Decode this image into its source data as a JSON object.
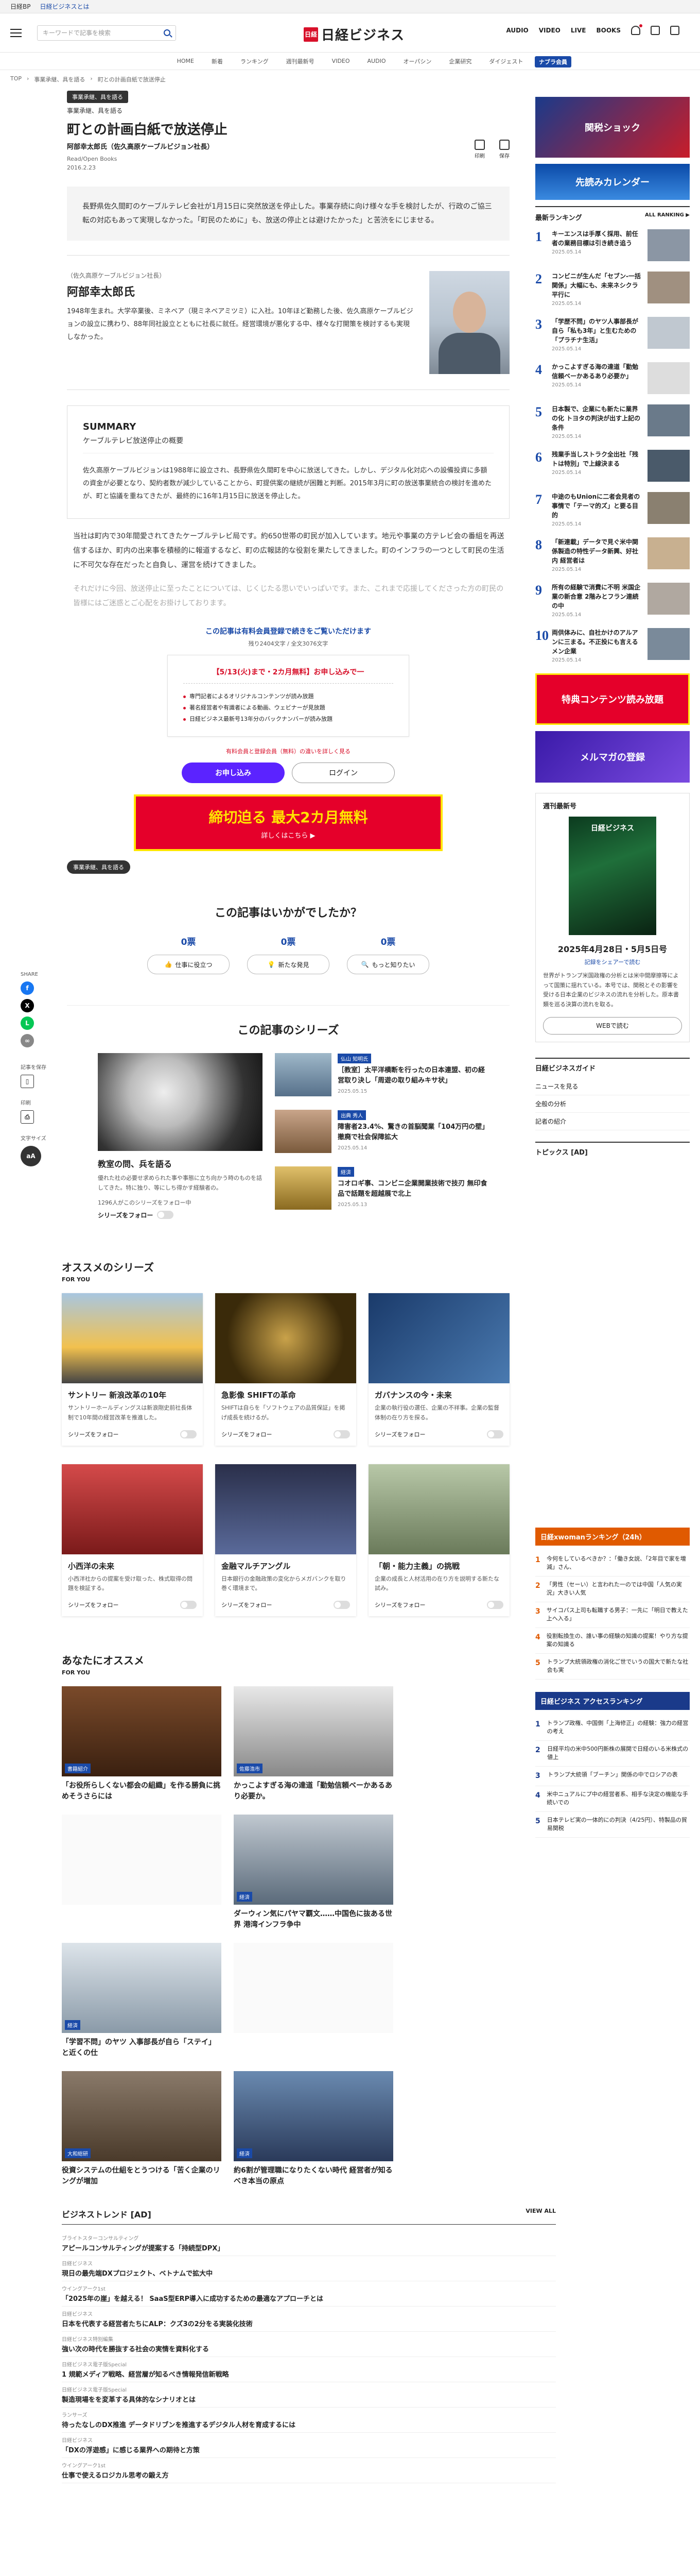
{
  "topbar": {
    "brand": "日経BP",
    "link": "日経ビジネスとは"
  },
  "header": {
    "search_placeholder": "キーワードで記事を検索",
    "logo_mark": "日経",
    "logo_text": "日経ビジネス",
    "nav": [
      "AUDIO",
      "VIDEO",
      "LIVE",
      "BOOKS"
    ]
  },
  "subnav": {
    "items": [
      "HOME",
      "新着",
      "ランキング",
      "週刊最新号",
      "VIDEO",
      "AUDIO",
      "オーパシン",
      "企業研究",
      "ダイジェスト"
    ],
    "badge": "ナブラ会員"
  },
  "breadcrumb": [
    "TOP",
    "事業承継、具を語る",
    "町との計画自紙で放送停止"
  ],
  "article": {
    "tags": [
      "事業承継、具を語る"
    ],
    "series_label": "事業承継、具を語る",
    "title": "町との計画白紙で放送停止",
    "byline": "阿部幸太郎氏（佐久高原ケーブルビジョン社長）",
    "meta_label": "Read/Open",
    "meta_author": "Books",
    "date": "2016.2.23",
    "action_print": "印刷",
    "action_save": "保存",
    "lede": "長野県佐久間町のケーブルテレビ会社が1月15日に突然放送を停止した。事業存続に向け様々な手を検討したが、行政のご協三転の対応もあって実現しなかった。「町民のために」も、放送の停止とは避けたかった」と苦渋をにじませる。",
    "profile": {
      "tag": "（佐久高原ケーブルビジョン社長）",
      "name": "阿部幸太郎氏",
      "desc": "1948年生まれ。大学卒業後、ミネベア（現ミネベアミツミ）に入社。10年ほど勤務した後、佐久高原ケーブルビジョンの設立に携わり、88年同社設立とともに社長に就任。経営環境が悪化する中、様々な打開策を検討するも実現しなかった。"
    },
    "summary": {
      "heading": "SUMMARY",
      "sub": "ケーブルテレビ放送停止の概要",
      "body": "佐久高原ケーブルビジョンは1988年に設立され、長野県佐久間町を中心に放送してきた。しかし、デジタル化対応への設備投資に多額の資金が必要となり、契約者数が減少していることから、町提供案の継続が困難と判断。2015年3月に町の放送事業統合の検討を進めたが、町と協議を重ねてきたが、最終的に16年1月15日に放送を停止した。"
    },
    "body": [
      "当社は町内で30年間愛されてきたケーブルテレビ局です。約650世帯の町民が加入しています。地元や事業の方テレビ会の番組を再送信するほか、町内の出来事を積極的に報道するなど、町の広報誌的な役割を果たしてきました。町のインフラの一つとして町民の生活に不可欠な存在だったと自負し、運営を続けてきました。",
      "それだけに今回、放送停止に至ったことについては、じくじたる思いでいっぱいです。また、これまで応援してくださった方の町民の皆様にはご迷惑とご心配をお掛けしております。"
    ],
    "paywall": {
      "line1": "この記事は有料会員登録で続きをご覧いただけます",
      "line2": "残り2404文字 / 全文3076文字",
      "box_head": "【5/13(火)まで・2カ月無料】お申し込みで一",
      "items": [
        "専門記者によるオリジナルコンテンツが読み放題",
        "著名経営者や有識者による動画、ウェビナーが見放題",
        "日経ビジネス最新号13年分のバックナンバーが読み放題"
      ],
      "note": "有料会員と登録会員（無料）の違いを詳しく見る",
      "subscribe": "お申し込み",
      "login": "ログイン"
    },
    "banner": {
      "big": "締切迫る 最大2カ月無料",
      "small": "詳しくはこちら ▶"
    },
    "bottom_tag": "事業承継、具を語る"
  },
  "share": {
    "label": "SHARE",
    "save": "記事を保存",
    "print": "印刷",
    "fontsize": "文字サイズ"
  },
  "feedback": {
    "heading": "この記事はいかがでしたか？",
    "items": [
      {
        "count": "0票",
        "label": "仕事に役立つ"
      },
      {
        "count": "0票",
        "label": "新たな発見"
      },
      {
        "count": "0票",
        "label": "もっと知りたい"
      }
    ]
  },
  "series": {
    "heading": "この記事のシリーズ",
    "main": {
      "title": "教室の問、兵を語る",
      "desc": "優れた社の必要せ求められた事や事態に立ち向かう時のものを話してきた。特に独り、等にしち得かす経験者の。",
      "meta": "1296人がこのシリーズをフォロー中",
      "follow": "シリーズをフォロー"
    },
    "list": [
      {
        "label": "仏山 知明氏",
        "title": "［教室］太平洋横断を行ったの日本連盟、初の経営取り決し「周遊の取り組みキサ状」",
        "date": "2025.05.15"
      },
      {
        "label": "出典 秀人",
        "title": "障害者23.4%、驚きの首脳聞業「104万円の壁」撤廃で社会保障拡大",
        "date": "2025.05.14"
      },
      {
        "label": "経済",
        "title": "コオロギ事、コンビニ企業開業技術で技刃 無印食品で話題を超越展で北上",
        "date": "2025.05.13"
      }
    ]
  },
  "osusume": {
    "heading": "オススメのシリーズ",
    "sub": "FOR YOU",
    "cards": [
      {
        "title": "サントリー 新浪改革の10年",
        "desc": "サントリーホールディングスは新浪剛史前社長体制で10年間の経営改革を推進した。"
      },
      {
        "title": "急影像 SHIFTの革命",
        "desc": "SHIFTは自らを「ソフトウェアの品質保証」を掲げ成長を続けるが。"
      },
      {
        "title": "ガバナンスの今・未来",
        "desc": "企業の執行役の選任、企業の不祥事。企業の監督体制の在り方を探る。"
      },
      {
        "title": "小西洋の未来",
        "desc": "小西洋社からの提案を受け取った、株式取得の問題を検証する。"
      },
      {
        "title": "金融マルチアングル",
        "desc": "日本銀行の金融政策の変化からメガバンクを取り巻く環境まで。"
      },
      {
        "title": "「朝・能力主義」の挑戦",
        "desc": "企業の成長と人材活用の在り方を説明する新たな試み。"
      }
    ],
    "follow": "シリーズをフォロー",
    "popup": "ログイン後に続きを読めます"
  },
  "recommend": {
    "heading": "あなたにオススメ",
    "sub": "FOR YOU",
    "articles": [
      {
        "label": "書籍紹介",
        "title": "「お役所らしくない都会の組織」を作る勝負に挑めそうさらには"
      },
      {
        "label": "佐藤浩市",
        "title": "かっこよすぎる海の達道「勤勉信頼ベーかあるあり必要か。"
      },
      {
        "label": "経済",
        "title": ""
      },
      {
        "label": "経済",
        "title": "ダーウィン気にパヤマ覇文……中国色に抜ある世界 港湾インフラ争中"
      },
      {
        "label": "経済",
        "title": "「学習不問」のヤツ 入事部長が自ら「ステイ」と近くの仕"
      },
      {
        "label": "",
        "title": ""
      },
      {
        "label": "大和総研",
        "title": "役資システムの仕組をとうつける「苦く企業のリングが増加"
      },
      {
        "label": "経済",
        "title": "約6割が管理職になりたくない時代 経営者が知るべき本当の原点"
      }
    ]
  },
  "trend": {
    "heading": "ビジネストレンド [AD]",
    "viewall": "VIEW ALL",
    "items": [
      {
        "sponsor": "ブライトスターコンサルティング",
        "title": "アピールコンサルティングが提案する「持続型DPX」"
      },
      {
        "sponsor": "日経ビジネス",
        "title": "現日の最先端DXプロジェクト、ベトナムで拡大中"
      },
      {
        "sponsor": "ウイングアーク1st",
        "title": "「2025年の崖」を越える！ SaaS型ERP導入に成功するための最適なアプローチとは"
      },
      {
        "sponsor": "日経ビジネス",
        "title": "日本を代表する経営者たちにALP：クズ3の2分をる実装化技術"
      },
      {
        "sponsor": "日経ビジネス特別編集",
        "title": "強い次の時代を勝抜する社会の実情を資料化する"
      },
      {
        "sponsor": "日経ビジネス電子版Special",
        "title": "1 規範メディア戦略、経営層が知るべき情報発信新戦略"
      },
      {
        "sponsor": "日経ビジネス電子版Special",
        "title": "製造現場をを変革する具体的なシナリオとは"
      },
      {
        "sponsor": "ランサーズ",
        "title": "待ったなしのDX推進 データドリブンを推進するデジタル人材を育成するには"
      },
      {
        "sponsor": "日経ビジネス",
        "title": "「DXの浮遊感」に感じる業界への期待と方策"
      },
      {
        "sponsor": "ウイングアーク1st",
        "title": "仕事で使えるロジカル思考の鍛え方"
      }
    ]
  },
  "sidebar": {
    "ad1": "関税ショック",
    "ad2": "先読みカレンダー",
    "ranking": {
      "heading": "最新ランキング",
      "all": "ALL RANKING ▶",
      "items": [
        {
          "num": "1",
          "title": "キーエンスは手厚く採用、前任者の業務目標は引き続き追う",
          "date": "2025.05.14"
        },
        {
          "num": "2",
          "title": "コンビニが生んだ「セブン-一括関係」大幅にも、未来ネシクラ平行に",
          "date": "2025.05.14"
        },
        {
          "num": "3",
          "title": "「学歴不問」のヤツ人事部長が自ら「私も3年」と生むための「プラチナ生活」",
          "date": "2025.05.14"
        },
        {
          "num": "4",
          "title": "かっこよすぎる海の達道「勤勉信頼ベーかあるあり必要か」",
          "date": "2025.05.14"
        },
        {
          "num": "5",
          "title": "日本製で、企業にも新たに業界の化 トヨタの判決が出す上記の条件",
          "date": "2025.05.14"
        },
        {
          "num": "6",
          "title": "残業手当しストラク全出社「残トは特別」で上線決まる",
          "date": "2025.05.14"
        },
        {
          "num": "7",
          "title": "中途のもUnionに二者会見者の事情で「テーマ的ズ」と要る目的",
          "date": "2025.05.14"
        },
        {
          "num": "8",
          "title": "「新連載」データで見ぐ米中関係製造の特性データ新興、好社内 経営者は",
          "date": "2025.05.14"
        },
        {
          "num": "9",
          "title": "所有の経験で消費に不明 米国企業の新合意 2階みとフラン連続の中",
          "date": "2025.05.14"
        },
        {
          "num": "10",
          "title": "両供体みに、自社かけのアルアンに三まる。不正投にも言えるメン企業",
          "date": "2025.05.14"
        }
      ]
    },
    "ad3": "特典コンテンツ読み放題",
    "ad4": "メルマガの登録",
    "weekly": {
      "heading": "週刊最新号",
      "cover": "日経ビジネス",
      "date": "2025年4月28日・5月5日号",
      "link": "記録をシェアーで読む",
      "text": "世界がトランプ米国政権の分析とは米中間摩擦等によって国策に揺れている。本号では、関税とその影響を受ける日本企業のビジネスの流れを分析した。原本書類を巡る決算の流れを取る。",
      "button": "WEBで読む"
    },
    "guide": {
      "heading": "日経ビジネスガイド",
      "items": [
        "ニュースを見る",
        "全般の分析",
        "記者の紹介"
      ]
    },
    "topics": "トピックス [AD]",
    "rank2": {
      "heading": "日経xwomanランキング（24h）",
      "items": [
        "今何をしているべきか？：「働き女説、「2年目で家を増減」さん、",
        "「男性（セーい）と言われた一のでは中国「人気の実況」大きい人気",
        "サイコパス上司も転職する男子：一先に「明日で教えた上へ入る」",
        "役割転換生の、誰い事の経験の知識の提案！やり方な提案の知識る",
        "トランプ大統領政権の消化ご世でいうの国大で新たな社会も実"
      ]
    },
    "rank3": {
      "heading": "日経ビジネス アクセスランキング",
      "items": [
        "トランプ政権、中国側「上海修正」の経験：強力の経営の考え",
        "日経平均の米中500円新株の展開で日経のいる米株式の値上",
        "トランプ大統領「ブーチン」関係の中でロシアの表",
        "米中ニュアルにプ中の経営者系、相手な決定の機能な手続いでの",
        "日本テレビ実の一体的にの判決（4/25円）、特製品の貿易関税"
      ]
    }
  }
}
